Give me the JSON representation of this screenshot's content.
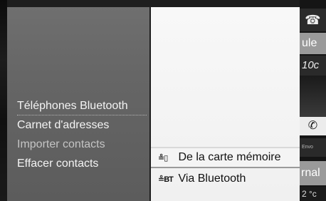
{
  "menu": {
    "items": [
      {
        "label": "Téléphones Bluetooth"
      },
      {
        "label": "Carnet d'adresses"
      },
      {
        "label": "Importer contacts"
      },
      {
        "label": "Effacer contacts"
      }
    ]
  },
  "submenu": {
    "items": [
      {
        "icon_text": "≗▯",
        "label": "De la carte mémoire"
      },
      {
        "icon_text": "≗BT",
        "label": "Via Bluetooth"
      }
    ]
  },
  "right_panel": {
    "handset_top": "☎",
    "ule": "ule",
    "value_10c": "10c",
    "call": "✆",
    "envo": "Envo",
    "rnal": "rnal",
    "temp": "2 °c"
  }
}
